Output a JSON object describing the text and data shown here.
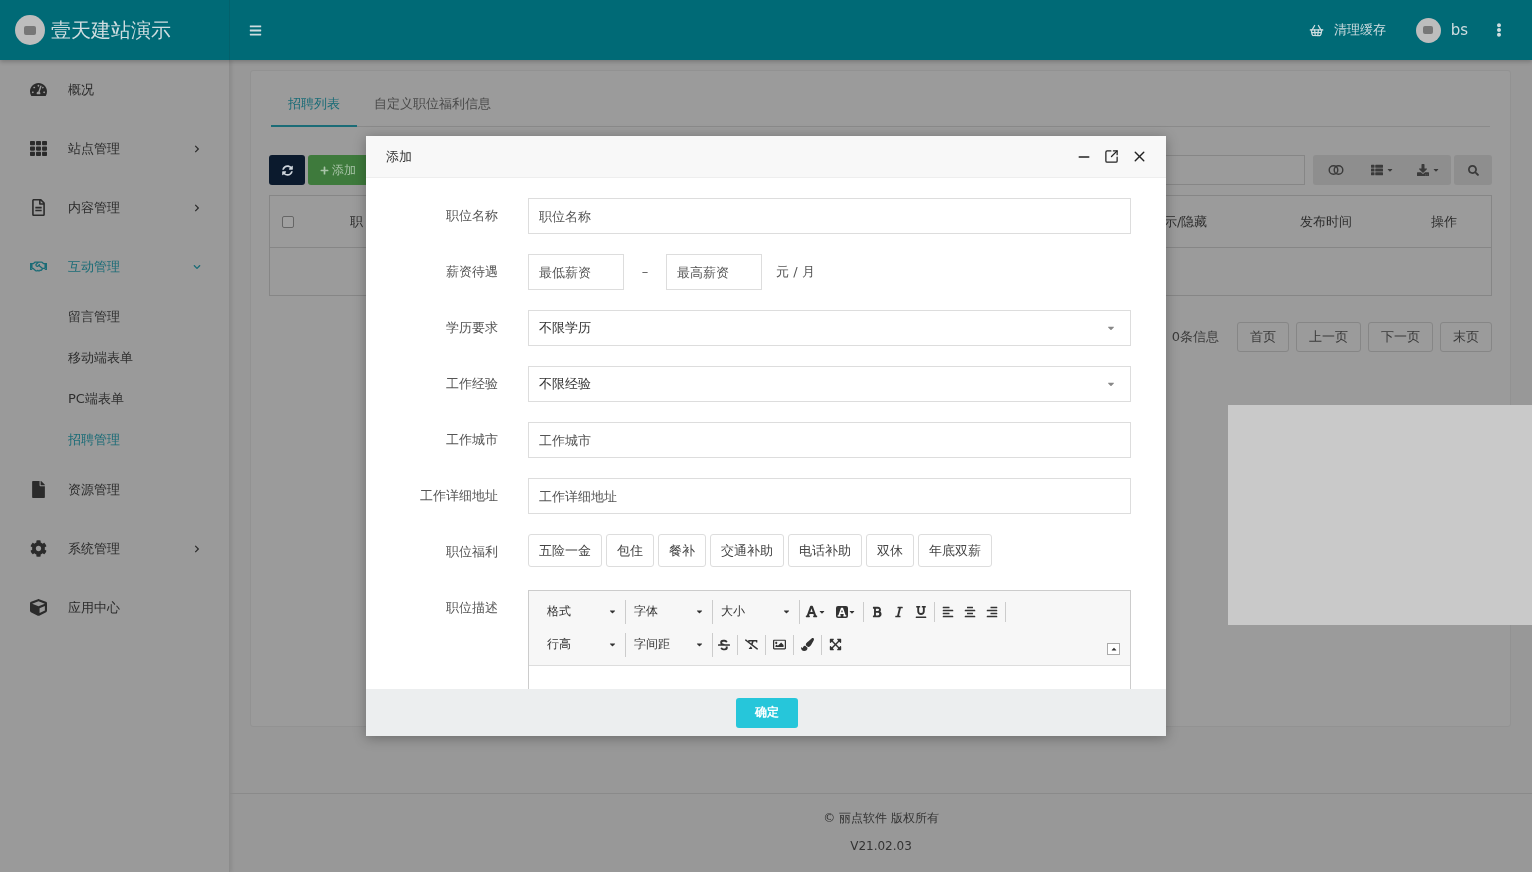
{
  "header": {
    "site_title": "壹天建站演示",
    "clear_cache": "清理缓存",
    "user": "bs"
  },
  "sidebar": {
    "items": [
      {
        "label": "概况",
        "kind": "link",
        "selected": false
      },
      {
        "label": "站点管理",
        "kind": "group",
        "expanded": false,
        "selected": false
      },
      {
        "label": "内容管理",
        "kind": "group",
        "expanded": false,
        "selected": false
      },
      {
        "label": "互动管理",
        "kind": "group",
        "expanded": true,
        "selected": true,
        "children": [
          {
            "label": "留言管理",
            "selected": false
          },
          {
            "label": "移动端表单",
            "selected": false
          },
          {
            "label": "PC端表单",
            "selected": false
          },
          {
            "label": "招聘管理",
            "selected": true
          }
        ]
      },
      {
        "label": "资源管理",
        "kind": "link",
        "selected": false
      },
      {
        "label": "系统管理",
        "kind": "group",
        "expanded": false,
        "selected": false
      },
      {
        "label": "应用中心",
        "kind": "link",
        "selected": false
      }
    ]
  },
  "tabs": [
    {
      "label": "招聘列表",
      "selected": true
    },
    {
      "label": "自定义职位福利信息",
      "selected": false
    }
  ],
  "toolbar": {
    "add_button": "添加"
  },
  "table": {
    "header_checkbox": {
      "checked": false
    },
    "columns": [
      "职",
      "示/隐藏",
      "发布时间",
      "操作"
    ]
  },
  "pagination": {
    "info": "0条信息",
    "buttons": [
      "首页",
      "上一页",
      "下一页",
      "末页"
    ]
  },
  "footer": {
    "copyright": "© 丽点软件 版权所有",
    "version": "V21.02.03"
  },
  "modal": {
    "title": "添加",
    "fields": [
      {
        "kind": "text",
        "label": "职位名称",
        "placeholder": "职位名称"
      },
      {
        "kind": "range",
        "label": "薪资待遇",
        "min_placeholder": "最低薪资",
        "separator": "–",
        "max_placeholder": "最高薪资",
        "unit": "元 / 月"
      },
      {
        "kind": "select",
        "label": "学历要求",
        "value": "不限学历"
      },
      {
        "kind": "select",
        "label": "工作经验",
        "value": "不限经验"
      },
      {
        "kind": "text",
        "label": "工作城市",
        "placeholder": "工作城市"
      },
      {
        "kind": "text",
        "label": "工作详细地址",
        "placeholder": "工作详细地址"
      },
      {
        "kind": "tags",
        "label": "职位福利",
        "tags": [
          "五险一金",
          "包住",
          "餐补",
          "交通补助",
          "电话补助",
          "双休",
          "年底双薪"
        ]
      },
      {
        "kind": "editor",
        "label": "职位描述",
        "row1_dropdowns": [
          "格式",
          "字体",
          "大小"
        ],
        "row2_dropdowns": [
          "行高",
          "字间距"
        ]
      }
    ],
    "confirm": "确定"
  }
}
